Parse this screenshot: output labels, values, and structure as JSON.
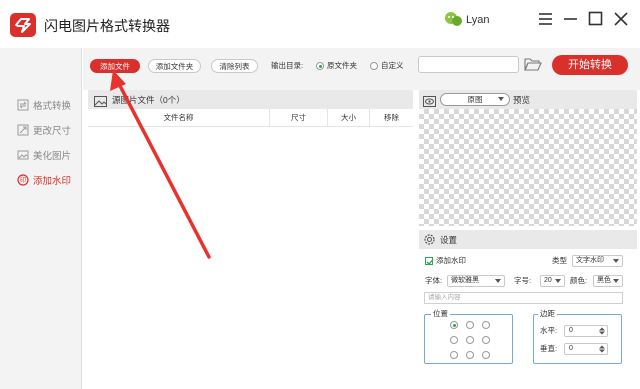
{
  "app": {
    "title": "闪电图片格式转换器"
  },
  "user": {
    "name": "Lyan"
  },
  "sidebar": {
    "items": [
      {
        "label": "格式转换",
        "active": false
      },
      {
        "label": "更改尺寸",
        "active": false
      },
      {
        "label": "美化图片",
        "active": false
      },
      {
        "label": "添加水印",
        "active": true
      }
    ]
  },
  "toolbar": {
    "add_file": "添加文件",
    "add_folder": "添加文件夹",
    "clear_list": "清除列表",
    "output_label": "输出目录:",
    "output_original": "原文件夹",
    "output_custom": "自定义",
    "output_selected": "原文件夹",
    "path_value": "",
    "start": "开始转换"
  },
  "files": {
    "header": "源图片文件（0个）",
    "columns": [
      "文件名称",
      "尺寸",
      "大小",
      "移除"
    ]
  },
  "preview": {
    "mode": "原图",
    "label": "预览"
  },
  "settings": {
    "title": "设置",
    "watermark_label": "添加水印",
    "watermark_checked": true,
    "type_label": "类型",
    "type_value": "文字水印",
    "font_label": "字体:",
    "font_value": "微软雅黑",
    "size_label": "字号:",
    "size_value": "20",
    "color_label": "颜色:",
    "color_value": "黑色",
    "text_placeholder": "请输入内容",
    "position_label": "位置",
    "margin_label": "边距",
    "h_label": "水平:",
    "h_value": "0",
    "v_label": "垂直:",
    "v_value": "0"
  },
  "colors": {
    "accent": "#d9302c",
    "check": "#2ea44f"
  }
}
